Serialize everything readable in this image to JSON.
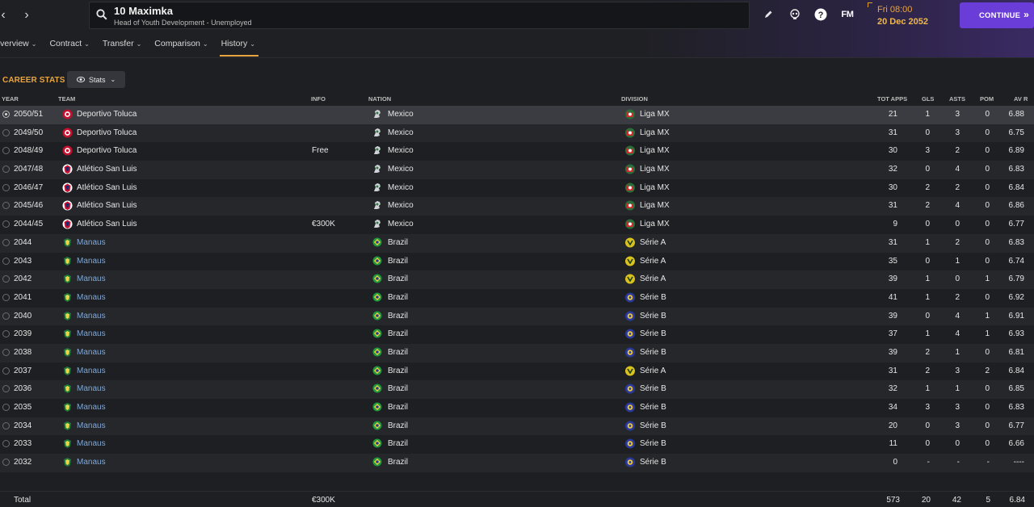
{
  "header": {
    "player_name": "10 Maximka",
    "player_role": "Head of Youth Development - Unemployed",
    "fm_label": "FM",
    "date_time": "Fri 08:00",
    "date_day": "20 Dec 2052",
    "continue_label": "CONTINUE"
  },
  "tabs": [
    {
      "label": "Overview"
    },
    {
      "label": "Contract"
    },
    {
      "label": "Transfer"
    },
    {
      "label": "Comparison"
    },
    {
      "label": "History",
      "active": true
    }
  ],
  "section": {
    "title": "CAREER STATS",
    "stats_button": "Stats"
  },
  "columns": {
    "year": "YEAR",
    "team": "TEAM",
    "info": "INFO",
    "nation": "NATION",
    "division": "DIVISION",
    "apps": "TOT APPS",
    "gls": "GLS",
    "asts": "ASTS",
    "pom": "POM",
    "avr": "AV R"
  },
  "colors": {
    "accent": "#e8a440",
    "continue": "#6a3cd8",
    "team_link": "#7fa8d8"
  },
  "rows": [
    {
      "year": "2050/51",
      "team": "Deportivo Toluca",
      "club_icon": "toluca-badge-icon",
      "info": "",
      "nation": "Mexico",
      "division": "Liga MX",
      "apps": "21",
      "gls": "1",
      "asts": "3",
      "pom": "0",
      "avr": "6.88",
      "selected": true
    },
    {
      "year": "2049/50",
      "team": "Deportivo Toluca",
      "club_icon": "toluca-badge-icon",
      "info": "",
      "nation": "Mexico",
      "division": "Liga MX",
      "apps": "31",
      "gls": "0",
      "asts": "3",
      "pom": "0",
      "avr": "6.75"
    },
    {
      "year": "2048/49",
      "team": "Deportivo Toluca",
      "club_icon": "toluca-badge-icon",
      "info": "Free",
      "nation": "Mexico",
      "division": "Liga MX",
      "apps": "30",
      "gls": "3",
      "asts": "2",
      "pom": "0",
      "avr": "6.89"
    },
    {
      "year": "2047/48",
      "team": "Atlético San Luis",
      "club_icon": "san-luis-badge-icon",
      "info": "",
      "nation": "Mexico",
      "division": "Liga MX",
      "apps": "32",
      "gls": "0",
      "asts": "4",
      "pom": "0",
      "avr": "6.83"
    },
    {
      "year": "2046/47",
      "team": "Atlético San Luis",
      "club_icon": "san-luis-badge-icon",
      "info": "",
      "nation": "Mexico",
      "division": "Liga MX",
      "apps": "30",
      "gls": "2",
      "asts": "2",
      "pom": "0",
      "avr": "6.84"
    },
    {
      "year": "2045/46",
      "team": "Atlético San Luis",
      "club_icon": "san-luis-badge-icon",
      "info": "",
      "nation": "Mexico",
      "division": "Liga MX",
      "apps": "31",
      "gls": "2",
      "asts": "4",
      "pom": "0",
      "avr": "6.86"
    },
    {
      "year": "2044/45",
      "team": "Atlético San Luis",
      "club_icon": "san-luis-badge-icon",
      "info": "€300K",
      "nation": "Mexico",
      "division": "Liga MX",
      "apps": "9",
      "gls": "0",
      "asts": "0",
      "pom": "0",
      "avr": "6.77"
    },
    {
      "year": "2044",
      "team": "Manaus",
      "club_icon": "manaus-badge-icon",
      "link": true,
      "info": "",
      "nation": "Brazil",
      "division": "Série A",
      "apps": "31",
      "gls": "1",
      "asts": "2",
      "pom": "0",
      "avr": "6.83"
    },
    {
      "year": "2043",
      "team": "Manaus",
      "club_icon": "manaus-badge-icon",
      "link": true,
      "info": "",
      "nation": "Brazil",
      "division": "Série A",
      "apps": "35",
      "gls": "0",
      "asts": "1",
      "pom": "0",
      "avr": "6.74"
    },
    {
      "year": "2042",
      "team": "Manaus",
      "club_icon": "manaus-badge-icon",
      "link": true,
      "info": "",
      "nation": "Brazil",
      "division": "Série A",
      "apps": "39",
      "gls": "1",
      "asts": "0",
      "pom": "1",
      "avr": "6.79"
    },
    {
      "year": "2041",
      "team": "Manaus",
      "club_icon": "manaus-badge-icon",
      "link": true,
      "info": "",
      "nation": "Brazil",
      "division": "Série B",
      "apps": "41",
      "gls": "1",
      "asts": "2",
      "pom": "0",
      "avr": "6.92"
    },
    {
      "year": "2040",
      "team": "Manaus",
      "club_icon": "manaus-badge-icon",
      "link": true,
      "info": "",
      "nation": "Brazil",
      "division": "Série B",
      "apps": "39",
      "gls": "0",
      "asts": "4",
      "pom": "1",
      "avr": "6.91"
    },
    {
      "year": "2039",
      "team": "Manaus",
      "club_icon": "manaus-badge-icon",
      "link": true,
      "info": "",
      "nation": "Brazil",
      "division": "Série B",
      "apps": "37",
      "gls": "1",
      "asts": "4",
      "pom": "1",
      "avr": "6.93"
    },
    {
      "year": "2038",
      "team": "Manaus",
      "club_icon": "manaus-badge-icon",
      "link": true,
      "info": "",
      "nation": "Brazil",
      "division": "Série B",
      "apps": "39",
      "gls": "2",
      "asts": "1",
      "pom": "0",
      "avr": "6.81"
    },
    {
      "year": "2037",
      "team": "Manaus",
      "club_icon": "manaus-badge-icon",
      "link": true,
      "info": "",
      "nation": "Brazil",
      "division": "Série A",
      "apps": "31",
      "gls": "2",
      "asts": "3",
      "pom": "2",
      "avr": "6.84"
    },
    {
      "year": "2036",
      "team": "Manaus",
      "club_icon": "manaus-badge-icon",
      "link": true,
      "info": "",
      "nation": "Brazil",
      "division": "Série B",
      "apps": "32",
      "gls": "1",
      "asts": "1",
      "pom": "0",
      "avr": "6.85"
    },
    {
      "year": "2035",
      "team": "Manaus",
      "club_icon": "manaus-badge-icon",
      "link": true,
      "info": "",
      "nation": "Brazil",
      "division": "Série B",
      "apps": "34",
      "gls": "3",
      "asts": "3",
      "pom": "0",
      "avr": "6.83"
    },
    {
      "year": "2034",
      "team": "Manaus",
      "club_icon": "manaus-badge-icon",
      "link": true,
      "info": "",
      "nation": "Brazil",
      "division": "Série B",
      "apps": "20",
      "gls": "0",
      "asts": "3",
      "pom": "0",
      "avr": "6.77"
    },
    {
      "year": "2033",
      "team": "Manaus",
      "club_icon": "manaus-badge-icon",
      "link": true,
      "info": "",
      "nation": "Brazil",
      "division": "Série B",
      "apps": "11",
      "gls": "0",
      "asts": "0",
      "pom": "0",
      "avr": "6.66"
    },
    {
      "year": "2032",
      "team": "Manaus",
      "club_icon": "manaus-badge-icon",
      "link": true,
      "info": "",
      "nation": "Brazil",
      "division": "Série B",
      "apps": "0",
      "gls": "-",
      "asts": "-",
      "pom": "-",
      "avr": "----"
    }
  ],
  "total": {
    "label": "Total",
    "info": "€300K",
    "apps": "573",
    "gls": "20",
    "asts": "42",
    "pom": "5",
    "avr": "6.84"
  }
}
